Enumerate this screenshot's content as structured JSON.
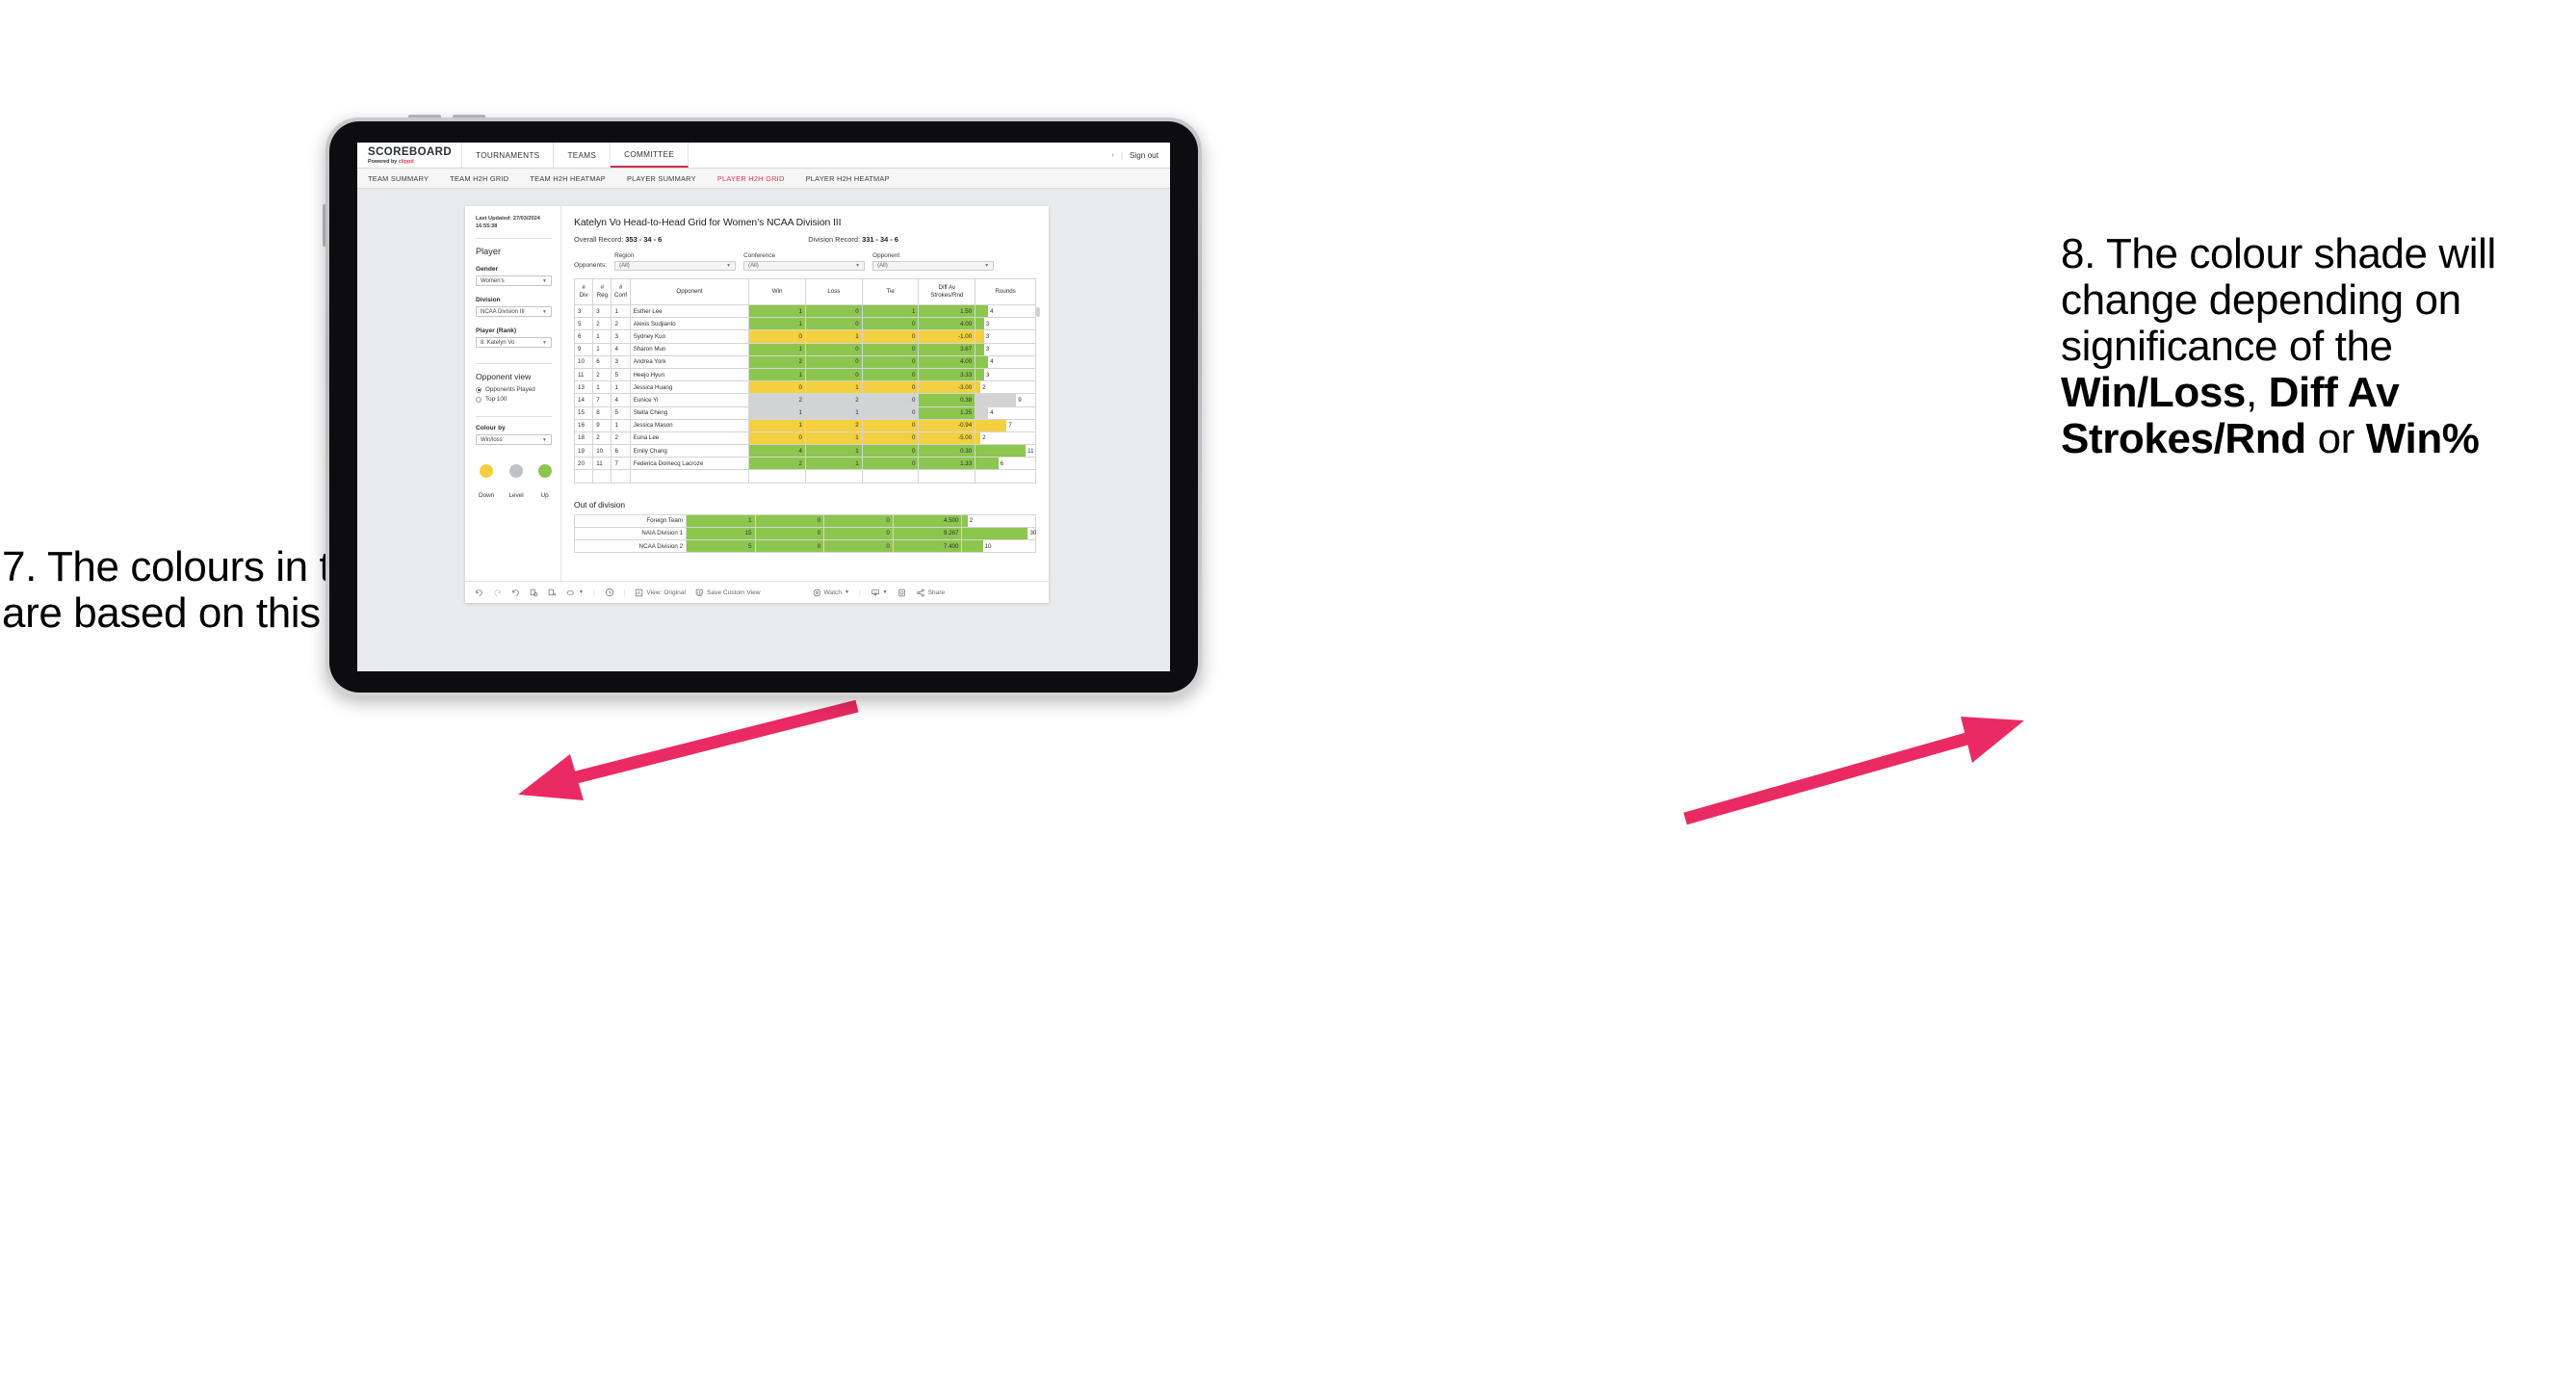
{
  "annotations": {
    "left": {
      "number": "7.",
      "text": "The colours in the grid are based on this selection"
    },
    "right": {
      "number": "8.",
      "lead": "The colour shade will change depending on significance of the ",
      "bold1": "Win/Loss",
      "mid1": ", ",
      "bold2": "Diff Av Strokes/Rnd",
      "mid2": " or ",
      "bold3": "Win%"
    },
    "arrow_color": "#ea2a63"
  },
  "app": {
    "brand": {
      "title": "SCOREBOARD",
      "powered_prefix": "Powered by ",
      "powered_brand": "clippd"
    },
    "nav_tabs": [
      {
        "label": "TOURNAMENTS",
        "active": false
      },
      {
        "label": "TEAMS",
        "active": false
      },
      {
        "label": "COMMITTEE",
        "active": true
      }
    ],
    "sign_out": "Sign out",
    "sub_tabs": [
      {
        "label": "TEAM SUMMARY",
        "active": false
      },
      {
        "label": "TEAM H2H GRID",
        "active": false
      },
      {
        "label": "TEAM H2H HEATMAP",
        "active": false
      },
      {
        "label": "PLAYER SUMMARY",
        "active": false
      },
      {
        "label": "PLAYER H2H GRID",
        "active": true
      },
      {
        "label": "PLAYER H2H HEATMAP",
        "active": false
      }
    ],
    "accent": "#e8344e"
  },
  "sidebar": {
    "last_updated": "Last Updated: 27/03/2024 16:55:38",
    "section_player": "Player",
    "gender": {
      "label": "Gender",
      "value": "Women’s"
    },
    "division": {
      "label": "Division",
      "value": "NCAA Division III"
    },
    "player_rank": {
      "label": "Player (Rank)",
      "value": "8. Katelyn Vo"
    },
    "opponent_view": {
      "title": "Opponent view",
      "options": [
        {
          "label": "Opponents Played",
          "selected": true
        },
        {
          "label": "Top 100",
          "selected": false
        }
      ]
    },
    "colour_by": {
      "label": "Colour by",
      "value": "Win/loss"
    },
    "legend": [
      {
        "label": "Down",
        "color": "#f2d03f"
      },
      {
        "label": "Level",
        "color": "#bfc3c7"
      },
      {
        "label": "Up",
        "color": "#8cc64f"
      }
    ]
  },
  "main": {
    "title": "Katelyn Vo Head-to-Head Grid for Women’s NCAA Division III",
    "overall_record_label": "Overall Record:",
    "overall_record_value": "353 -  34 - 6",
    "division_record_label": "Division Record:",
    "division_record_value": "331 -  34 - 6",
    "opponents_label": "Opponents:",
    "filters": [
      {
        "caption": "Region",
        "value": "(All)"
      },
      {
        "caption": "Conference",
        "value": "(All)"
      },
      {
        "caption": "Opponent",
        "value": "(All)"
      }
    ],
    "columns": [
      {
        "l1": "#",
        "l2": "Div"
      },
      {
        "l1": "#",
        "l2": "Reg"
      },
      {
        "l1": "#",
        "l2": "Conf"
      },
      {
        "l1": "Opponent",
        "l2": ""
      },
      {
        "l1": "Win",
        "l2": ""
      },
      {
        "l1": "Loss",
        "l2": ""
      },
      {
        "l1": "Tie",
        "l2": ""
      },
      {
        "l1": "Diff Av",
        "l2": "Strokes/Rnd"
      },
      {
        "l1": "Rounds",
        "l2": ""
      }
    ],
    "rows": [
      {
        "div": "3",
        "reg": "3",
        "conf": "1",
        "opponent": "Esther Lee",
        "win": "1",
        "loss": "0",
        "tie": "1",
        "diff": "1.50",
        "rounds": "4",
        "color": "#8cc64f",
        "diff_color": "#8cc64f",
        "bar_pct": 21
      },
      {
        "div": "5",
        "reg": "2",
        "conf": "2",
        "opponent": "Alexis Sudjianto",
        "win": "1",
        "loss": "0",
        "tie": "0",
        "diff": "4.00",
        "rounds": "3",
        "color": "#8cc64f",
        "diff_color": "#8cc64f",
        "bar_pct": 14
      },
      {
        "div": "6",
        "reg": "1",
        "conf": "3",
        "opponent": "Sydney Kuo",
        "win": "0",
        "loss": "1",
        "tie": "0",
        "diff": "-1.00",
        "rounds": "3",
        "color": "#f2d03f",
        "diff_color": "#f2d03f",
        "bar_pct": 14
      },
      {
        "div": "9",
        "reg": "1",
        "conf": "4",
        "opponent": "Sharon Mun",
        "win": "1",
        "loss": "0",
        "tie": "0",
        "diff": "3.67",
        "rounds": "3",
        "color": "#8cc64f",
        "diff_color": "#8cc64f",
        "bar_pct": 14
      },
      {
        "div": "10",
        "reg": "6",
        "conf": "3",
        "opponent": "Andrea York",
        "win": "2",
        "loss": "0",
        "tie": "0",
        "diff": "4.00",
        "rounds": "4",
        "color": "#8cc64f",
        "diff_color": "#8cc64f",
        "bar_pct": 21
      },
      {
        "div": "11",
        "reg": "2",
        "conf": "5",
        "opponent": "Heejo Hyun",
        "win": "1",
        "loss": "0",
        "tie": "0",
        "diff": "3.33",
        "rounds": "3",
        "color": "#8cc64f",
        "diff_color": "#8cc64f",
        "bar_pct": 14
      },
      {
        "div": "13",
        "reg": "1",
        "conf": "1",
        "opponent": "Jessica Huang",
        "win": "0",
        "loss": "1",
        "tie": "0",
        "diff": "-3.00",
        "rounds": "2",
        "color": "#f2d03f",
        "diff_color": "#f2d03f",
        "bar_pct": 8
      },
      {
        "div": "14",
        "reg": "7",
        "conf": "4",
        "opponent": "Eunice Yi",
        "win": "2",
        "loss": "2",
        "tie": "0",
        "diff": "0.38",
        "rounds": "9",
        "color": "#d2d3d5",
        "diff_color": "#8cc64f",
        "bar_pct": 68
      },
      {
        "div": "15",
        "reg": "8",
        "conf": "5",
        "opponent": "Stella Cheng",
        "win": "1",
        "loss": "1",
        "tie": "0",
        "diff": "1.25",
        "rounds": "4",
        "color": "#d2d3d5",
        "diff_color": "#8cc64f",
        "bar_pct": 21
      },
      {
        "div": "16",
        "reg": "9",
        "conf": "1",
        "opponent": "Jessica Mason",
        "win": "1",
        "loss": "2",
        "tie": "0",
        "diff": "-0.94",
        "rounds": "7",
        "color": "#f2d03f",
        "diff_color": "#f2d03f",
        "bar_pct": 52
      },
      {
        "div": "18",
        "reg": "2",
        "conf": "2",
        "opponent": "Euna Lee",
        "win": "0",
        "loss": "1",
        "tie": "0",
        "diff": "-5.00",
        "rounds": "2",
        "color": "#f2d03f",
        "diff_color": "#f2d03f",
        "bar_pct": 8
      },
      {
        "div": "19",
        "reg": "10",
        "conf": "6",
        "opponent": "Emily Chang",
        "win": "4",
        "loss": "1",
        "tie": "0",
        "diff": "0.30",
        "rounds": "11",
        "color": "#8cc64f",
        "diff_color": "#8cc64f",
        "bar_pct": 84
      },
      {
        "div": "20",
        "reg": "11",
        "conf": "7",
        "opponent": "Federica Domecq Lacroze",
        "win": "2",
        "loss": "1",
        "tie": "0",
        "diff": "1.33",
        "rounds": "6",
        "color": "#8cc64f",
        "diff_color": "#8cc64f",
        "bar_pct": 38
      }
    ],
    "out_of_division": {
      "title": "Out of division",
      "rows": [
        {
          "name": "Foreign Team",
          "win": "1",
          "loss": "0",
          "tie": "0",
          "diff": "4.500",
          "rounds": "2",
          "color": "#8cc64f",
          "bar_pct": 7
        },
        {
          "name": "NAIA Division 1",
          "win": "15",
          "loss": "0",
          "tie": "0",
          "diff": "9.267",
          "rounds": "30",
          "color": "#8cc64f",
          "bar_pct": 90
        },
        {
          "name": "NCAA Division 2",
          "win": "5",
          "loss": "0",
          "tie": "0",
          "diff": "7.400",
          "rounds": "10",
          "color": "#8cc64f",
          "bar_pct": 28
        }
      ]
    }
  },
  "toolbar": {
    "view_original": "View: Original",
    "save_custom_view": "Save Custom View",
    "watch": "Watch",
    "share": "Share"
  }
}
